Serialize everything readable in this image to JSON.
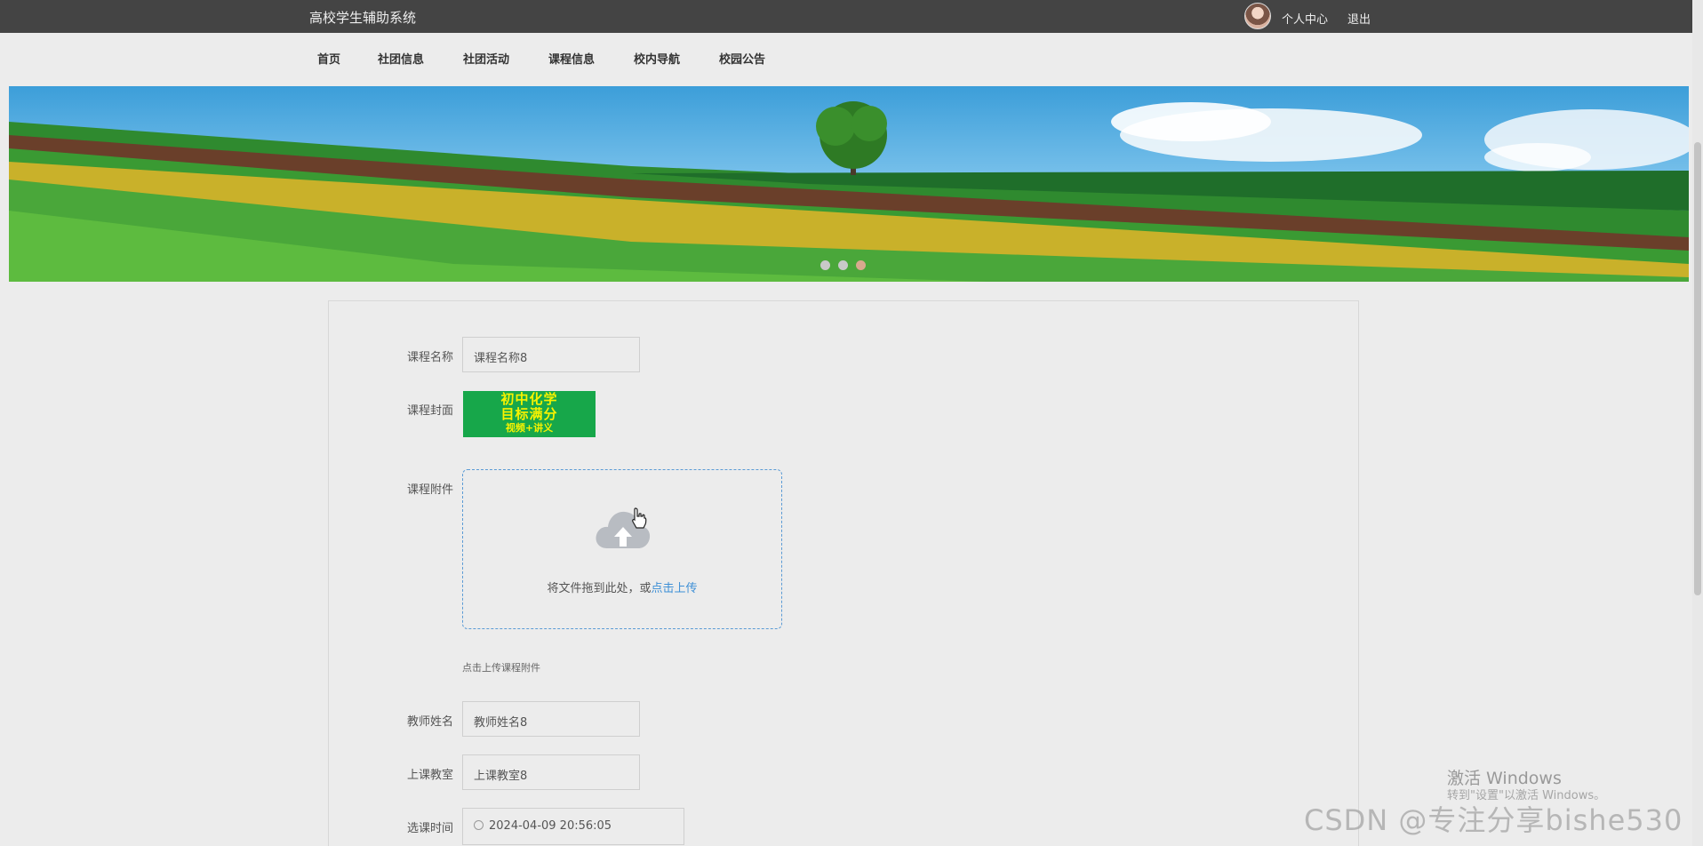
{
  "header": {
    "title": "高校学生辅助系统",
    "profile_label": "个人中心",
    "logout_label": "退出"
  },
  "nav": {
    "items": [
      "首页",
      "社团信息",
      "社团活动",
      "课程信息",
      "校内导航",
      "校园公告"
    ]
  },
  "banner": {
    "slide_count": 3,
    "active_slide": 3
  },
  "form": {
    "course_name": {
      "label": "课程名称",
      "value": "课程名称8"
    },
    "cover": {
      "label": "课程封面",
      "image_text": [
        "初中化学",
        "目标满分",
        "视频+讲义"
      ]
    },
    "attachment": {
      "label": "课程附件",
      "drop_text": "将文件拖到此处，或",
      "click_text": "点击上传",
      "tip": "点击上传课程附件"
    },
    "teacher_name": {
      "label": "教师姓名",
      "value": "教师姓名8"
    },
    "classroom": {
      "label": "上课教室",
      "value": "上课教室8"
    },
    "select_time": {
      "label": "选课时间",
      "value": "2024-04-09 20:56:05"
    }
  },
  "watermarks": {
    "windows_title": "激活 Windows",
    "windows_sub": "转到\"设置\"以激活 Windows。",
    "csdn": "CSDN @专注分享bishe530"
  },
  "colors": {
    "topbar": "#444444",
    "accent_link": "#3d8fd6",
    "cover_bg": "#17a74a",
    "cover_text": "#f7f200"
  }
}
